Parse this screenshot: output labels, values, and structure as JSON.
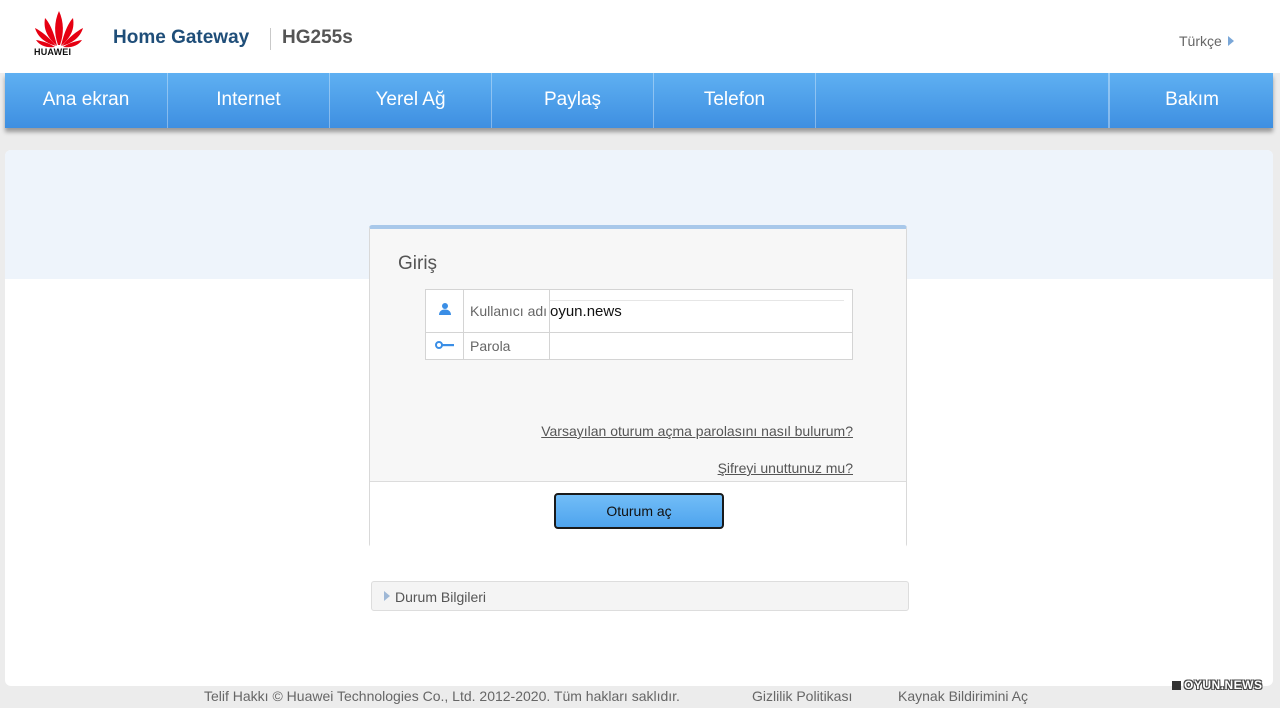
{
  "header": {
    "logo_text": "HUAWEI",
    "product_title": "Home Gateway",
    "model": "HG255s",
    "language": "Türkçe"
  },
  "nav": {
    "items": [
      {
        "label": "Ana ekran"
      },
      {
        "label": "Internet"
      },
      {
        "label": "Yerel Ağ"
      },
      {
        "label": "Paylaş"
      },
      {
        "label": "Telefon"
      },
      {
        "label": "Bakım"
      }
    ]
  },
  "login": {
    "title": "Giriş",
    "username_label": "Kullanıcı adı",
    "username_value": "oyun.news",
    "password_label": "Parola",
    "password_value": "",
    "default_password_link": "Varsayılan oturum açma parolasını nasıl bulurum?",
    "forgot_link": "Şifreyi unuttunuz mu?",
    "submit_label": "Oturum aç"
  },
  "status_panel": {
    "label": "Durum Bilgileri"
  },
  "footer": {
    "copyright": "Telif Hakkı © Huawei Technologies Co., Ltd. 2012-2020. Tüm hakları saklıdır.",
    "privacy": "Gizlilik Politikası",
    "open_source": "Kaynak Bildirimini Aç"
  },
  "watermark": "OYUN.NEWS",
  "colors": {
    "nav_blue": "#4a9be8",
    "brand_dark_blue": "#1f4e79",
    "huawei_red": "#e60012",
    "button_blue": "#5aaef2"
  }
}
